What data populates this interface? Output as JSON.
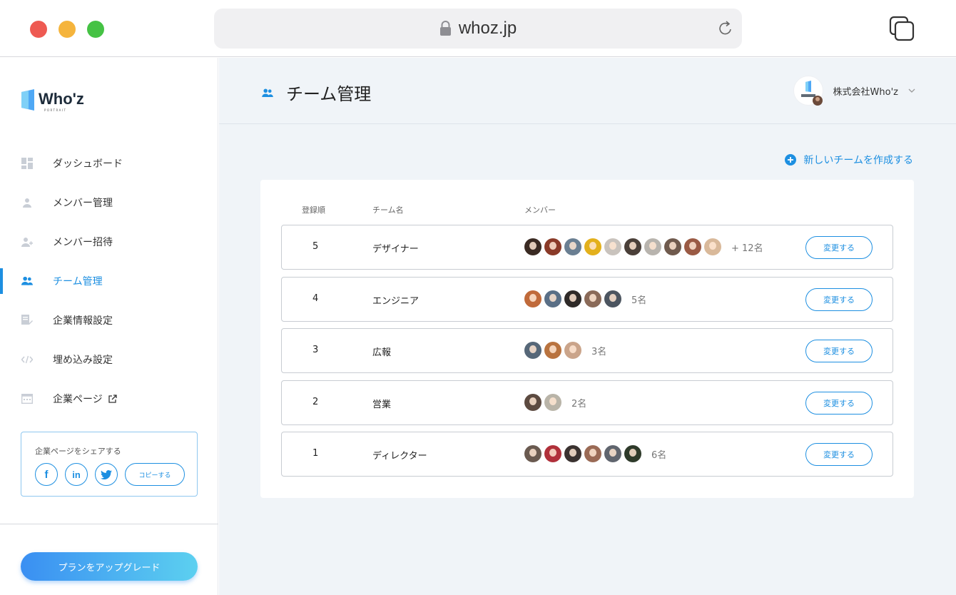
{
  "browser": {
    "url": "whoz.jp"
  },
  "sidebar": {
    "logo_text": "Who'z",
    "logo_subtext": "PORTRAIT",
    "items": [
      {
        "label": "ダッシュボード",
        "icon": "dashboard-icon"
      },
      {
        "label": "メンバー管理",
        "icon": "person-icon"
      },
      {
        "label": "メンバー招待",
        "icon": "person-add-icon"
      },
      {
        "label": "チーム管理",
        "icon": "team-icon",
        "active": true
      },
      {
        "label": "企業情報設定",
        "icon": "edit-document-icon"
      },
      {
        "label": "埋め込み設定",
        "icon": "code-icon"
      },
      {
        "label": "企業ページ",
        "icon": "calendar-page-icon"
      }
    ],
    "share": {
      "title": "企業ページをシェアする",
      "facebook": "f",
      "linkedin": "in",
      "copy_label": "コピーする"
    },
    "upgrade_label": "プランをアップグレード"
  },
  "header": {
    "title": "チーム管理",
    "company_name": "株式会社Who'z"
  },
  "main": {
    "new_team_label": "新しいチームを作成する",
    "columns": {
      "order": "登録順",
      "name": "チーム名",
      "members": "メンバー"
    },
    "change_label": "変更する",
    "teams": [
      {
        "order": "5",
        "name": "デザイナー",
        "count": "+ 12名",
        "avatars": [
          "#3a2a22",
          "#8a3a28",
          "#6a7f92",
          "#e3b01c",
          "#c9c3bd",
          "#4a3f38",
          "#b8b4ae",
          "#6f5a4d",
          "#9a5a44",
          "#d9b99a"
        ]
      },
      {
        "order": "4",
        "name": "エンジニア",
        "count": "5名",
        "avatars": [
          "#c06a3a",
          "#5a6f86",
          "#2f2a28",
          "#8a6a58",
          "#4c5560"
        ]
      },
      {
        "order": "3",
        "name": "広報",
        "count": "3名",
        "avatars": [
          "#566778",
          "#b9733f",
          "#caa48a"
        ]
      },
      {
        "order": "2",
        "name": "営業",
        "count": "2名",
        "avatars": [
          "#5c4a40",
          "#b9b4a8"
        ]
      },
      {
        "order": "1",
        "name": "ディレクター",
        "count": "6名",
        "avatars": [
          "#6a5a50",
          "#b0303a",
          "#3a3230",
          "#9a6a55",
          "#60656e",
          "#2e3a2a"
        ]
      }
    ]
  },
  "colors": {
    "accent": "#1d8fe1",
    "main_bg": "#f0f4f8",
    "upgrade_gradient_start": "#3a8ff2",
    "upgrade_gradient_end": "#5cd0f0"
  }
}
